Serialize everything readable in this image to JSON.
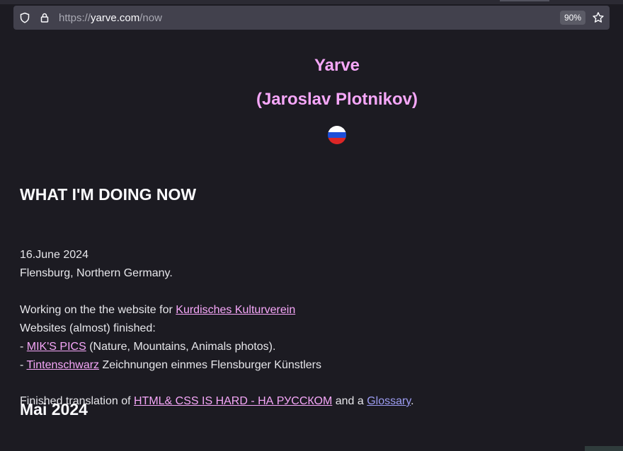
{
  "browser": {
    "url_prefix": "https://",
    "url_host": "yarve.com",
    "url_path": "/now",
    "zoom": "90%"
  },
  "header": {
    "name": "Yarve",
    "subtitle": "(Jaroslav Plotnikov)",
    "flag_colors": [
      "#ffffff",
      "#1d4ed8",
      "#dc2626"
    ]
  },
  "main": {
    "heading": "WHAT I'M DOING NOW",
    "date": "16.June 2024",
    "location": "Flensburg, Northern Germany.",
    "working_prefix": "Working on the the website for ",
    "working_link": "Kurdisches Kulturverein",
    "finished_label": "Websites (almost) finished:",
    "item1_dash": "- ",
    "item1_link": "MIK'S PICS",
    "item1_rest": " (Nature, Mountains, Animals photos).",
    "item2_dash": "- ",
    "item2_link": "Tintenschwarz",
    "item2_rest": " Zeichnungen einmes Flensburger Künstlers",
    "translation_prefix": "Finished translation of ",
    "translation_link": "HTML& CSS IS HARD - НА РУССКОМ",
    "translation_mid": " and a ",
    "glossary_link": "Glossary",
    "translation_end": ".",
    "next_heading": "Mai 2024"
  },
  "colors": {
    "background": "#1c1b22",
    "accent_pink": "#f6a7f9",
    "link_visited_blue": "#9d9df2",
    "text": "#e6e6ea"
  }
}
